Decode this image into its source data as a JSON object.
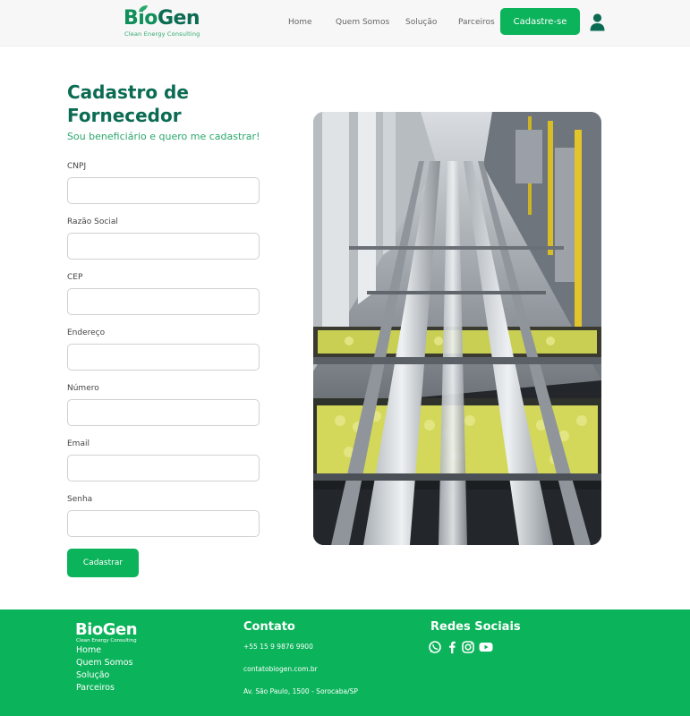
{
  "header": {
    "logo": {
      "word_left": "Bio",
      "word_right": "Gen",
      "tagline": "Clean Energy Consulting"
    },
    "nav": [
      {
        "label": "Home"
      },
      {
        "label": "Quem Somos"
      },
      {
        "label": "Solução"
      },
      {
        "label": "Parceiros"
      }
    ],
    "cta_label": "Cadastre-se",
    "user_icon": "user-icon"
  },
  "form": {
    "title": "Cadastro de Fornecedor",
    "subtitle": "Sou beneficiário e quero me cadastrar!",
    "fields": [
      {
        "label": "CNPJ",
        "value": ""
      },
      {
        "label": "Razão Social",
        "value": ""
      },
      {
        "label": "CEP",
        "value": ""
      },
      {
        "label": "Endereço",
        "value": ""
      },
      {
        "label": "Número",
        "value": ""
      },
      {
        "label": "Email",
        "value": ""
      },
      {
        "label": "Senha",
        "value": ""
      }
    ],
    "submit_label": "Cadastrar"
  },
  "footer": {
    "logo": {
      "word": "BioGen",
      "tagline": "Clean Energy Consulting"
    },
    "links": [
      {
        "label": "Home"
      },
      {
        "label": "Quem Somos"
      },
      {
        "label": "Solução"
      },
      {
        "label": "Parceiros"
      }
    ],
    "contact_heading": "Contato",
    "phone": "+55 15 9 9876 9900",
    "email": "contatobiogen.com.br",
    "address": "Av. São Paulo, 1500 - Sorocaba/SP",
    "social_heading": "Redes Sociais",
    "social_icons": [
      "whatsapp-icon",
      "facebook-icon",
      "instagram-icon",
      "youtube-icon"
    ]
  },
  "colors": {
    "primary_green": "#0bb35a",
    "dark_green": "#0b6b53",
    "accent_green": "#2aa86b",
    "header_bg": "#f7f7f7"
  }
}
